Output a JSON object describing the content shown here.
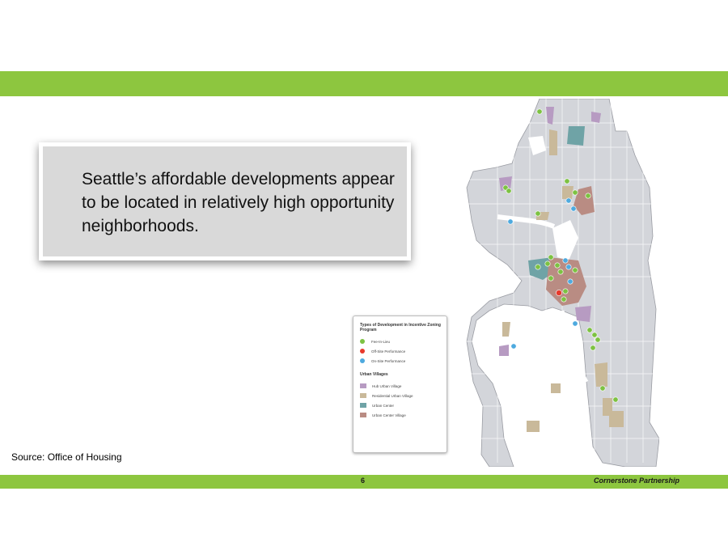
{
  "slide": {
    "callout_text": "Seattle’s affordable developments appear to be located in relatively high opportunity neighborhoods.",
    "source": "Source: Office of Housing",
    "page_number": "6",
    "company": "Cornerstone Partnership",
    "band_color": "#8dc63f"
  },
  "legend": {
    "title1": "Types of Development in Incentive Zoning Program",
    "dev_types": [
      {
        "label": "Fee-In-Lieu",
        "color": "#7dc242"
      },
      {
        "label": "Off-Site Performance",
        "color": "#e8392b"
      },
      {
        "label": "On-Site Performance",
        "color": "#4eaadf"
      }
    ],
    "title2": "Urban Villages",
    "villages": [
      {
        "label": "Hub Urban Village",
        "color": "#b79bc2"
      },
      {
        "label": "Residential Urban Village",
        "color": "#c9b99a"
      },
      {
        "label": "Urban Center",
        "color": "#6fa3a6"
      },
      {
        "label": "Urban Center Village",
        "color": "#b98c83"
      }
    ]
  }
}
